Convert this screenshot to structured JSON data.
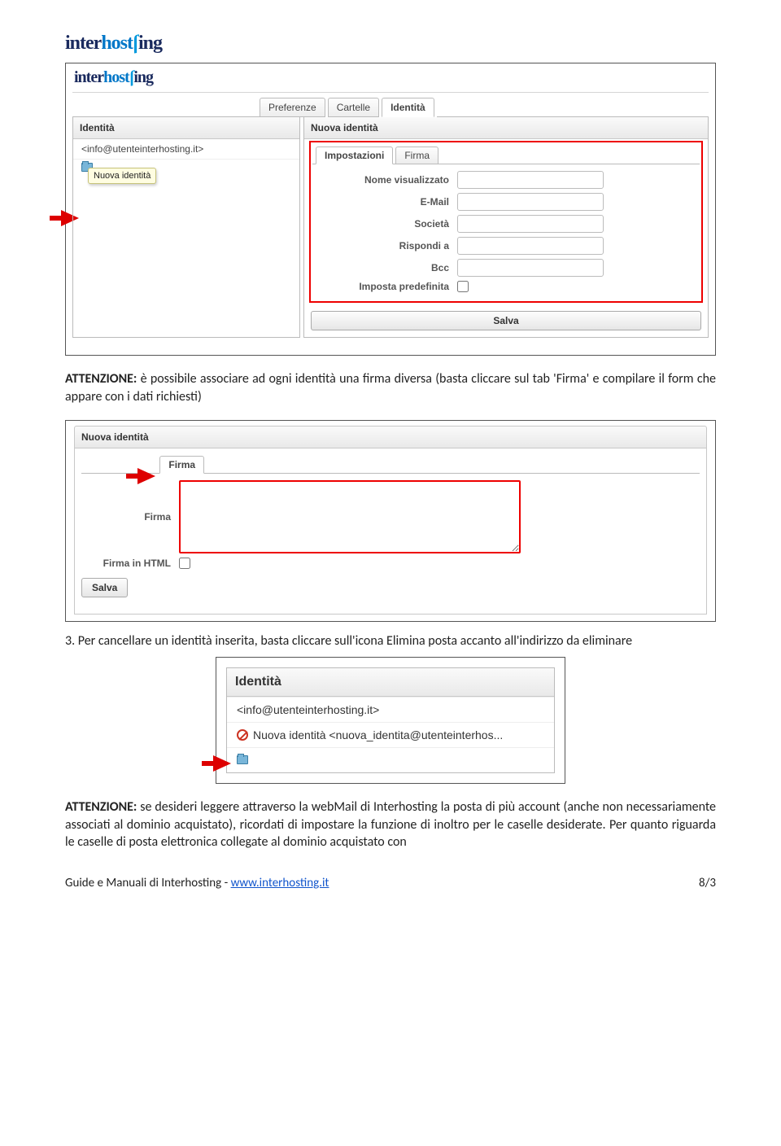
{
  "logo": {
    "part1": "inter",
    "part2": "host",
    "part3": "ing"
  },
  "screenshot1": {
    "tabs": [
      "Preferenze",
      "Cartelle",
      "Identità"
    ],
    "activeTab": "Identità",
    "sidebar": {
      "title": "Identità",
      "item": "<info@utenteinterhosting.it>",
      "tooltip": "Nuova identità"
    },
    "right": {
      "title": "Nuova identità",
      "subtabs": [
        "Impostazioni",
        "Firma"
      ],
      "fields": {
        "display_name": "Nome visualizzato",
        "email": "E-Mail",
        "company": "Società",
        "reply_to": "Rispondi a",
        "bcc": "Bcc",
        "default": "Imposta predefinita"
      },
      "save": "Salva"
    }
  },
  "para1": {
    "bold": "ATTENZIONE:",
    "text": " è possibile associare ad ogni identità una firma diversa (basta cliccare sul tab 'Firma' e compilare il form che appare con i dati richiesti)"
  },
  "step3": "3. Per cancellare un identità inserita, basta cliccare sull'icona Elimina posta accanto all'indirizzo da eliminare",
  "screenshot2": {
    "title": "Nuova identità",
    "tab_firma": "Firma",
    "field_firma": "Firma",
    "field_html": "Firma in HTML",
    "save": "Salva"
  },
  "screenshot3": {
    "title": "Identità",
    "row1": "<info@utenteinterhosting.it>",
    "row2": "Nuova identità <nuova_identita@utenteinterhos..."
  },
  "para2": {
    "bold": "ATTENZIONE:",
    "text": " se desideri leggere attraverso la webMail di Interhosting la posta di più account (anche non necessariamente associati al dominio acquistato), ricordati di impostare la funzione di inoltro per le caselle desiderate. Per quanto riguarda le caselle di posta elettronica collegate al dominio acquistato con"
  },
  "footer": {
    "left": "Guide e Manuali di Interhosting - ",
    "link": "www.interhosting.it",
    "page": "8/3"
  }
}
